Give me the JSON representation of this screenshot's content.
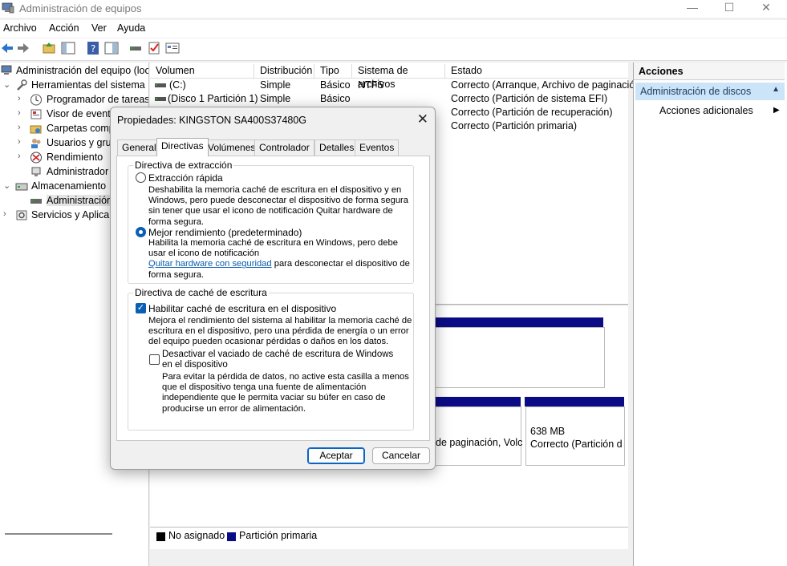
{
  "window": {
    "title": "Administración de equipos",
    "minimize": "—",
    "maximize": "☐",
    "close": "✕"
  },
  "menu": [
    "Archivo",
    "Acción",
    "Ver",
    "Ayuda"
  ],
  "tree": {
    "root": "Administración del equipo (loc",
    "tools": "Herramientas del sistema",
    "scheduler": "Programador de tareas",
    "events": "Visor de evento",
    "folders": "Carpetas comp",
    "users": "Usuarios y grup",
    "performance": "Rendimiento",
    "devices": "Administrador",
    "storage": "Almacenamiento",
    "disks": "Administración",
    "services": "Servicios y Aplica"
  },
  "list": {
    "columns": [
      "Volumen",
      "Distribución",
      "Tipo",
      "Sistema de archivos",
      "Estado"
    ],
    "rows": [
      {
        "volume": "(C:)",
        "layout": "Simple",
        "type": "Básico",
        "fs": "NTFS",
        "status": "Correcto (Arranque, Archivo de paginació"
      },
      {
        "volume": "(Disco 1 Partición 1)",
        "layout": "Simple",
        "type": "Básico",
        "fs": "",
        "status": "Correcto (Partición de sistema EFI)"
      },
      {
        "volume": "",
        "layout": "",
        "type": "",
        "fs": "",
        "status": "Correcto (Partición de recuperación)"
      },
      {
        "volume": "",
        "layout": "",
        "type": "",
        "fs": "",
        "status": "Correcto (Partición primaria)"
      }
    ]
  },
  "graph": {
    "partition_text": "de paginación, Volc",
    "small_part_size": "638 MB",
    "small_part_status": "Correcto (Partición d"
  },
  "legend": {
    "unallocated": "No asignado",
    "primary": "Partición primaria",
    "unallocated_color": "#000000",
    "primary_color": "#0b0b86"
  },
  "actions": {
    "header": "Acciones",
    "selected": "Administración de discos",
    "more": "Acciones adicionales"
  },
  "dialog": {
    "title": "Propiedades: KINGSTON SA400S37480G",
    "tabs": [
      "General",
      "Directivas",
      "Volúmenes",
      "Controlador",
      "Detalles",
      "Eventos"
    ],
    "removal": {
      "title": "Directiva de extracción",
      "quick_label": "Extracción rápida",
      "quick_desc": [
        "Deshabilita la memoria caché de escritura en el dispositivo y en",
        "Windows, pero puede desconectar el dispositivo de forma segura",
        "sin tener que usar el icono de notificación Quitar hardware de",
        "forma segura."
      ],
      "better_label": "Mejor rendimiento (predeterminado)",
      "better_desc": [
        "Habilita la memoria caché de escritura en Windows, pero debe",
        "usar el icono de notificación"
      ],
      "better_link": "Quitar hardware con seguridad",
      "better_desc_tail": " para desconectar el dispositivo de",
      "better_desc_end": "forma segura."
    },
    "cache": {
      "title": "Directiva de caché de escritura",
      "enable_label": "Habilitar caché de escritura en el dispositivo",
      "enable_desc": [
        "Mejora el rendimiento del sistema al habilitar la memoria caché de",
        "escritura en el dispositivo, pero una pérdida de energía o un error",
        "del equipo pueden ocasionar pérdidas o daños en los datos."
      ],
      "flush_label": [
        "Desactivar el vaciado de caché de escritura de Windows",
        "en el dispositivo"
      ],
      "flush_desc": [
        "Para evitar la pérdida de datos, no active esta casilla a menos",
        "que el dispositivo tenga una fuente de alimentación",
        "independiente que le permita vaciar su búfer en caso de",
        "producirse un error de alimentación."
      ]
    },
    "ok": "Aceptar",
    "cancel": "Cancelar"
  }
}
